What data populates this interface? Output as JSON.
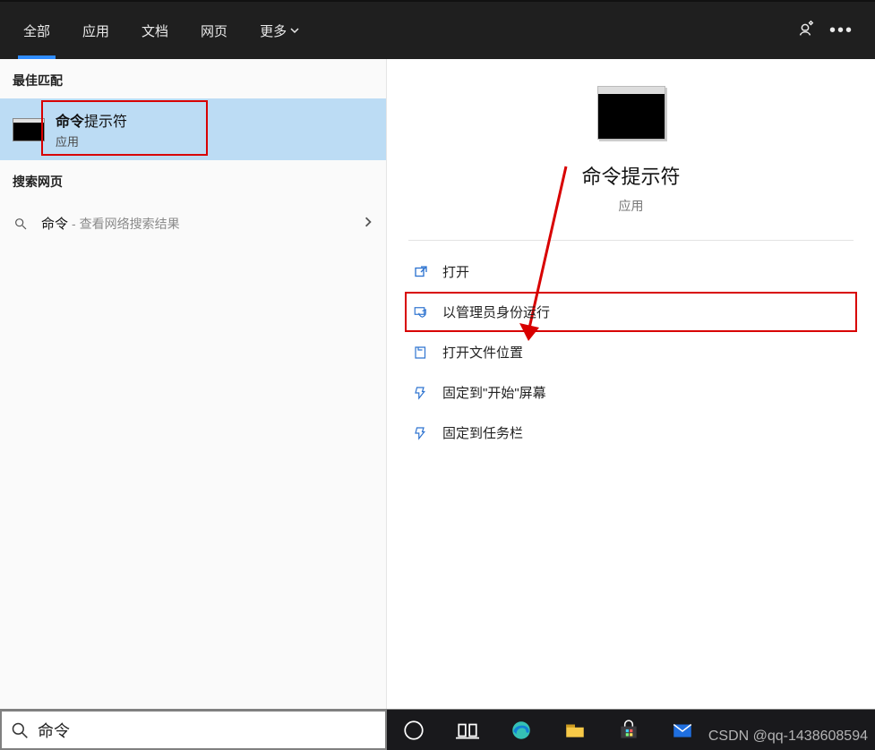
{
  "tabs": {
    "all": "全部",
    "apps": "应用",
    "docs": "文档",
    "web": "网页",
    "more": "更多"
  },
  "sections": {
    "best_match": "最佳匹配",
    "search_web": "搜索网页"
  },
  "best_match": {
    "title_bold": "命令",
    "title_rest": "提示符",
    "subtitle": "应用"
  },
  "web_result": {
    "query": "命令",
    "hint": "- 查看网络搜索结果"
  },
  "detail": {
    "title": "命令提示符",
    "subtitle": "应用"
  },
  "actions": {
    "open": "打开",
    "run_as_admin": "以管理员身份运行",
    "open_file_location": "打开文件位置",
    "pin_to_start": "固定到\"开始\"屏幕",
    "pin_to_taskbar": "固定到任务栏"
  },
  "icons": {
    "feedback": "feedback-icon",
    "ellipsis": "ellipsis-icon",
    "search": "search-icon",
    "chevron_right": "chevron-right-icon",
    "open": "open-icon",
    "shield": "shield-icon",
    "folder": "folder-icon",
    "pin": "pin-icon"
  },
  "search": {
    "value": "命令"
  },
  "watermark": "CSDN @qq-1438608594",
  "colors": {
    "accent": "#2f8cff",
    "highlight_bg": "#bcdcf4",
    "annotation": "#d80000"
  }
}
